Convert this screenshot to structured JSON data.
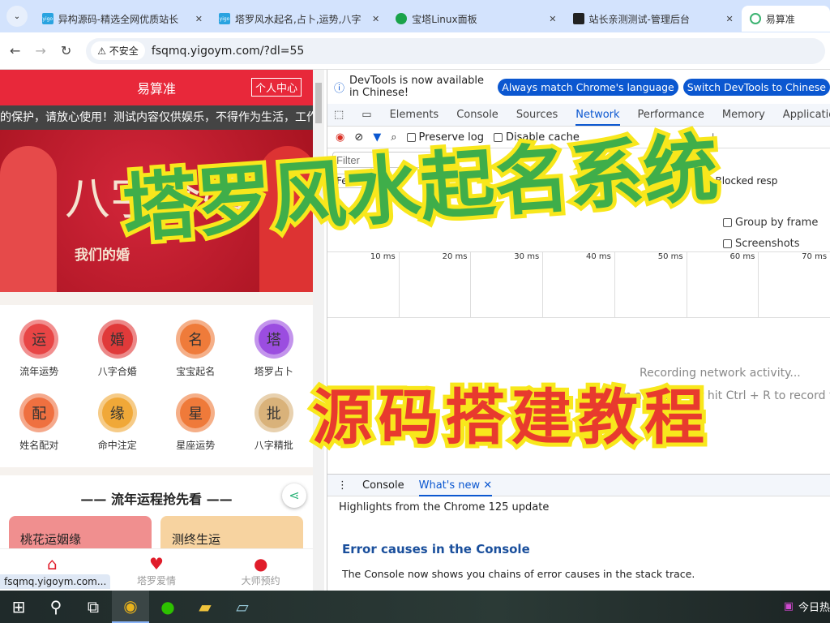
{
  "browser": {
    "tabs": [
      {
        "title": "异构源码-精选全网优质站长",
        "fav": "yigo"
      },
      {
        "title": "塔罗风水起名,占卜,运势,八字",
        "fav": "yigo"
      },
      {
        "title": "宝塔Linux面板",
        "fav": ""
      },
      {
        "title": "站长亲测测试-管理后台",
        "fav": ""
      },
      {
        "title": "易算准",
        "fav": ""
      }
    ],
    "security": "不安全",
    "url": "fsqmq.yigoym.com/?dl=55",
    "status_url": "fsqmq.yigoym.com..."
  },
  "page": {
    "title": "易算准",
    "user_center": "个人中心",
    "notice": "的保护，请放心使用！测试内容仅供娱乐，不得作为生活，工作",
    "banner_title": "八字合婚",
    "banner_sub": "我们的婚",
    "grid": [
      {
        "label": "流年运势",
        "glyph": "运",
        "color": "#e84545"
      },
      {
        "label": "八字合婚",
        "glyph": "婚",
        "color": "#e03a3a"
      },
      {
        "label": "宝宝起名",
        "glyph": "名",
        "color": "#ef7b3a"
      },
      {
        "label": "塔罗占卜",
        "glyph": "塔",
        "color": "#9b4de0"
      },
      {
        "label": "姓名配对",
        "glyph": "配",
        "color": "#ef7040"
      },
      {
        "label": "命中注定",
        "glyph": "缘",
        "color": "#f0a838"
      },
      {
        "label": "星座运势",
        "glyph": "星",
        "color": "#ef7a3a"
      },
      {
        "label": "八字精批",
        "glyph": "批",
        "color": "#d9b27a"
      }
    ],
    "section_title": "流年运程抢先看",
    "cards": [
      {
        "label": "桃花运姻缘"
      },
      {
        "label": "测终生运"
      }
    ],
    "bottom_nav": [
      {
        "label": ""
      },
      {
        "label": "塔罗爱情"
      },
      {
        "label": "大师预约"
      }
    ]
  },
  "devtools": {
    "info": "DevTools is now available in Chinese!",
    "btn1": "Always match Chrome's language",
    "btn2": "Switch DevTools to Chinese",
    "tabs": [
      "Elements",
      "Console",
      "Sources",
      "Network",
      "Performance",
      "Memory",
      "Application"
    ],
    "preserve_log": "Preserve log",
    "disable_cache": "Disable cache",
    "filter_placeholder": "Filter",
    "fetch": "Fetch",
    "blocked": "Blocked resp",
    "group_by_frame": "Group by frame",
    "screenshots": "Screenshots",
    "ticks": [
      "10 ms",
      "20 ms",
      "30 ms",
      "40 ms",
      "50 ms",
      "60 ms",
      "70 ms"
    ],
    "recording": "Recording network activity...",
    "record_hint": "Perform a request or hit Ctrl + R to record the re",
    "drawer_console": "Console",
    "drawer_whatsnew": "What's new",
    "highlights": "Highlights from the Chrome 125 update",
    "err_title": "Error causes in the Console",
    "err_desc": "The Console now shows you chains of error causes in the stack trace."
  },
  "taskbar": {
    "tray": "今日热"
  },
  "overlay": {
    "line1": "塔罗风水起名系统",
    "line2": "源码搭建教程"
  }
}
